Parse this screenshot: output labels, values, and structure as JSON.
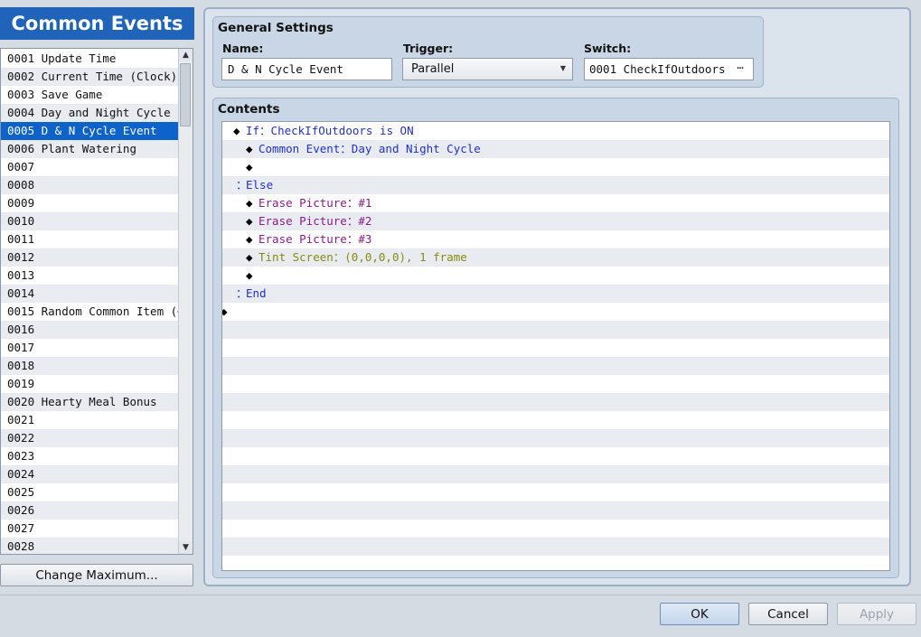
{
  "common_events": {
    "title": "Common Events",
    "items": [
      "0001 Update Time",
      "0002 Current Time (Clock)",
      "0003 Save Game",
      "0004 Day and Night Cycle",
      "0005 D & N Cycle Event",
      "0006 Plant Watering",
      "0007",
      "0008",
      "0009",
      "0010",
      "0011",
      "0012",
      "0013",
      "0014",
      "0015 Random Common Item (⋯",
      "0016",
      "0017",
      "0018",
      "0019",
      "0020 Hearty Meal Bonus",
      "0021",
      "0022",
      "0023",
      "0024",
      "0025",
      "0026",
      "0027",
      "0028"
    ],
    "selected_index": 4,
    "change_maximum_label": "Change Maximum..."
  },
  "general_settings": {
    "title": "General Settings",
    "name_label": "Name:",
    "name_value": "D & N Cycle Event",
    "trigger_label": "Trigger:",
    "trigger_value": "Parallel",
    "switch_label": "Switch:",
    "switch_value": "0001 CheckIfOutdoors",
    "switch_button": "⋯"
  },
  "contents": {
    "title": "Contents",
    "rows": [
      {
        "indent": 0,
        "prefix": "◆",
        "text": "If：CheckIfOutdoors is ON",
        "color": "blue"
      },
      {
        "indent": 1,
        "prefix": "◆",
        "text": "Common Event：Day and Night Cycle",
        "color": "blue"
      },
      {
        "indent": 1,
        "prefix": "◆",
        "text": "",
        "color": "blue"
      },
      {
        "indent": 0,
        "prefix": "：",
        "text": "Else",
        "color": "blue"
      },
      {
        "indent": 1,
        "prefix": "◆",
        "text": "Erase Picture：#1",
        "color": "purple"
      },
      {
        "indent": 1,
        "prefix": "◆",
        "text": "Erase Picture：#2",
        "color": "purple"
      },
      {
        "indent": 1,
        "prefix": "◆",
        "text": "Erase Picture：#3",
        "color": "purple"
      },
      {
        "indent": 1,
        "prefix": "◆",
        "text": "Tint Screen：(0,0,0,0), 1 frame",
        "color": "olive"
      },
      {
        "indent": 1,
        "prefix": "◆",
        "text": "",
        "color": "blue"
      },
      {
        "indent": 0,
        "prefix": "：",
        "text": "End",
        "color": "blue"
      },
      {
        "indent": -1,
        "prefix": "◆",
        "text": "",
        "color": "blue"
      }
    ],
    "total_rows": 25
  },
  "buttons": {
    "ok": "OK",
    "cancel": "Cancel",
    "apply": "Apply"
  },
  "colors": {
    "header_blue": "#1f64b8",
    "selection": "#0d63c9",
    "cmd_blue": "#2230c4",
    "cmd_purple": "#8a1c8a",
    "cmd_olive": "#8a8a12"
  }
}
